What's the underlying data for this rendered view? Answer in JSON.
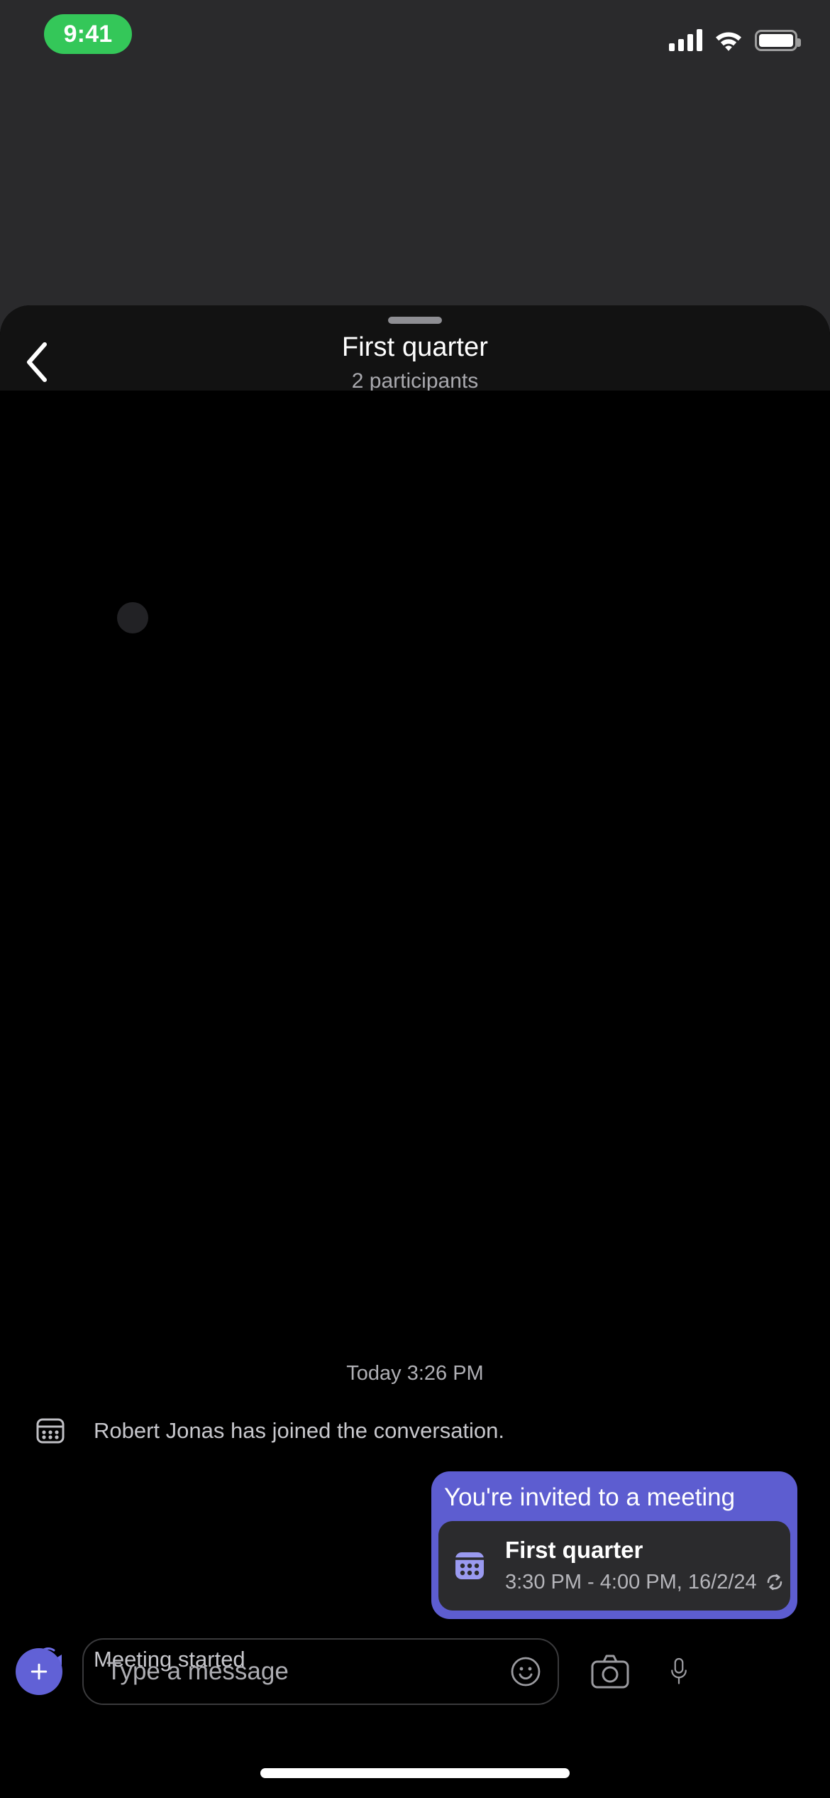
{
  "status_bar": {
    "time": "9:41",
    "time_pill_color": "#34C759",
    "signal_icon": "cellular-signal-icon",
    "wifi_icon": "wifi-icon",
    "battery_icon": "battery-icon"
  },
  "header": {
    "grabber": "sheet-grabber",
    "back_icon": "back-chevron-icon",
    "title": "First quarter",
    "subtitle": "2 participants"
  },
  "conversation": {
    "daystamp": "Today 3:26 PM",
    "system_messages": [
      {
        "icon": "calendar-icon",
        "text": "Robert Jonas has joined the conversation."
      },
      {
        "icon": "video-camera-icon",
        "text": "Meeting started"
      }
    ],
    "invite": {
      "headline": "You're invited to a meeting",
      "bubble_color": "#5D5DD0",
      "card": {
        "icon": "calendar-filled-icon",
        "title": "First quarter",
        "time": "3:30 PM - 4:00 PM, 16/2/24",
        "recurring_icon": "recurring-icon"
      }
    }
  },
  "composer": {
    "add_label": "+",
    "placeholder": "Type a message",
    "value": "",
    "emoji_icon": "emoji-smiley-icon",
    "camera_icon": "camera-icon",
    "microphone_icon": "microphone-icon",
    "accent_color": "#6161D6"
  }
}
